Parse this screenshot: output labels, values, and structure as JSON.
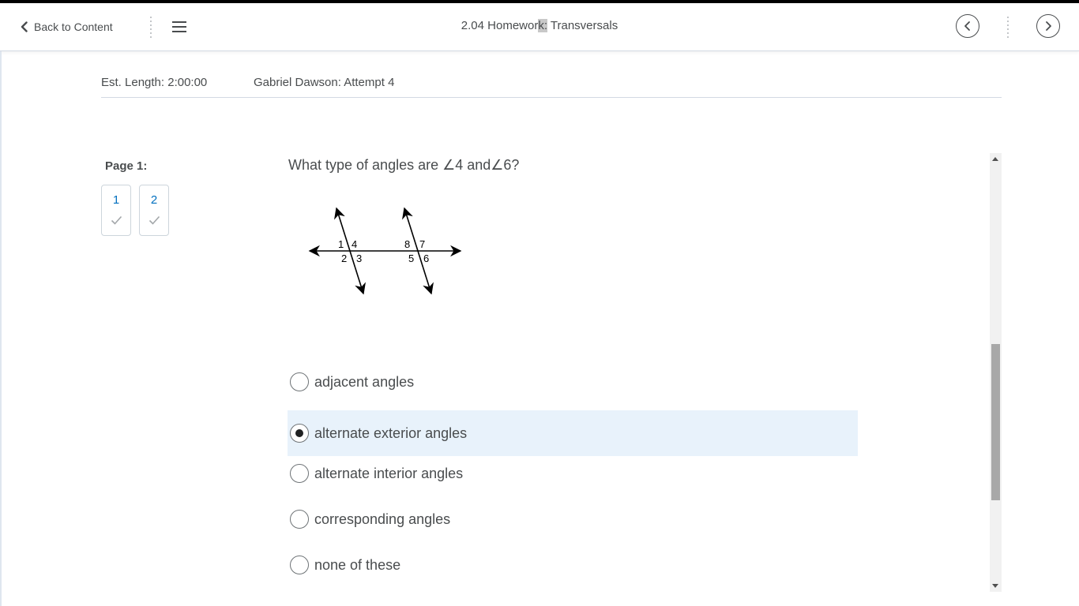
{
  "header": {
    "back_label": "Back to Content",
    "title_part1": "2.04 Homewor",
    "title_highlight": "k:",
    "title_part2": " Transversals"
  },
  "meta": {
    "est_length": "Est. Length: 2:00:00",
    "attempt": "Gabriel Dawson: Attempt 4"
  },
  "sidebar": {
    "page_label": "Page 1:",
    "questions": [
      {
        "number": "1",
        "answered": true
      },
      {
        "number": "2",
        "answered": true
      }
    ]
  },
  "question": {
    "text": "What type of angles are ∠4 and∠6?",
    "figure_labels": [
      "1",
      "4",
      "2",
      "3",
      "8",
      "7",
      "5",
      "6"
    ]
  },
  "options": [
    {
      "label": "adjacent angles",
      "selected": false
    },
    {
      "label": "alternate exterior angles",
      "selected": true
    },
    {
      "label": "alternate interior angles",
      "selected": false
    },
    {
      "label": "corresponding angles",
      "selected": false
    },
    {
      "label": "none of these",
      "selected": false
    }
  ],
  "colors": {
    "accent_link": "#006fbf",
    "selected_bg": "#e8f2fb",
    "text": "#494c4e"
  },
  "icons": [
    "chevron-left-icon",
    "kebab-icon",
    "hamburger-menu-icon",
    "circle-chevron-left-icon",
    "circle-chevron-right-icon",
    "checkmark-icon"
  ]
}
